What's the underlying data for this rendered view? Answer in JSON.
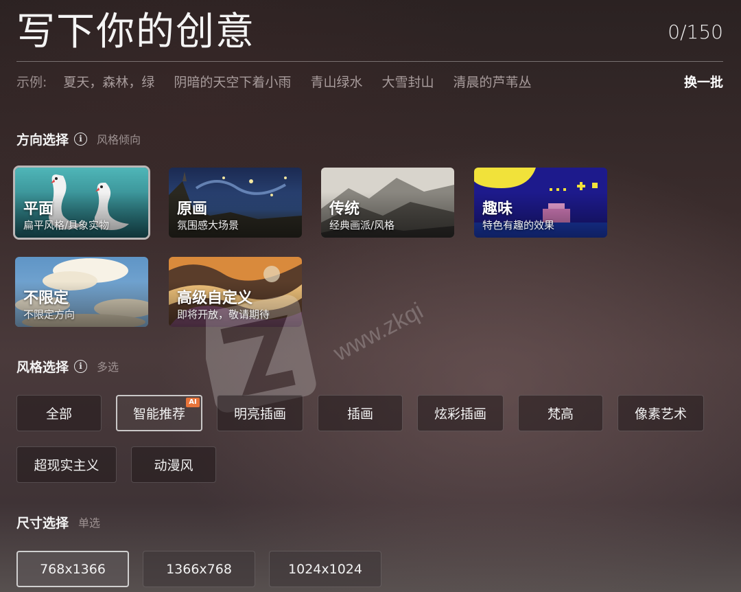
{
  "header": {
    "title": "写下你的创意",
    "counter": "0/150"
  },
  "examples": {
    "lead": "示例:",
    "items": [
      "夏天，森林，绿",
      "阴暗的天空下着小雨",
      "青山绿水",
      "大雪封山",
      "清晨的芦苇丛"
    ],
    "refresh_label": "换一批"
  },
  "direction": {
    "label": "方向选择",
    "sub": "风格倾向",
    "cards": [
      {
        "name": "平面",
        "desc": "扁平风格/具象实物",
        "selected": true
      },
      {
        "name": "原画",
        "desc": "氛围感大场景"
      },
      {
        "name": "传统",
        "desc": "经典画派/风格"
      },
      {
        "name": "趣味",
        "desc": "特色有趣的效果"
      },
      {
        "name": "不限定",
        "desc": "不限定方向"
      },
      {
        "name": "高级自定义",
        "desc": "即将开放，敬请期待"
      }
    ]
  },
  "style": {
    "label": "风格选择",
    "sub": "多选",
    "chips": [
      "全部",
      "智能推荐",
      "明亮插画",
      "插画",
      "炫彩插画",
      "梵高",
      "像素艺术",
      "超现实主义",
      "动漫风"
    ],
    "selected": "智能推荐",
    "ai_badge": "AI"
  },
  "size": {
    "label": "尺寸选择",
    "sub": "单选",
    "options": [
      "768x1366",
      "1366x768",
      "1024x1024"
    ],
    "selected": "768x1366"
  },
  "watermark": {
    "text": "www.zkqi"
  }
}
